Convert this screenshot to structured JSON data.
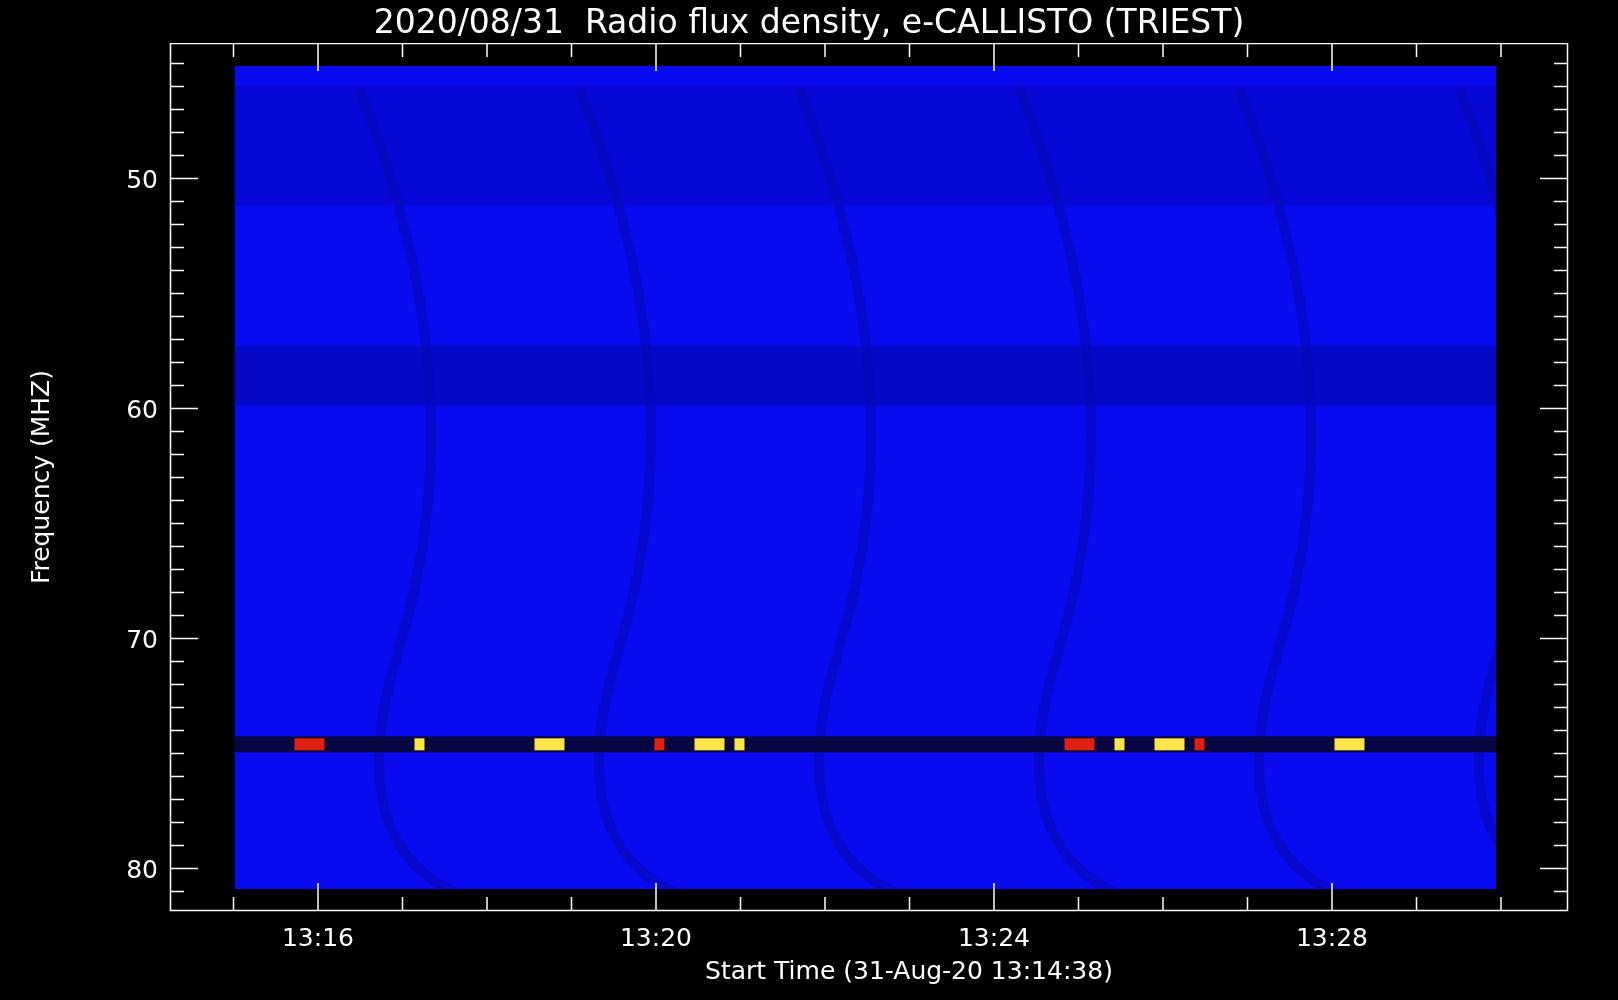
{
  "title": "2020/08/31  Radio flux density, e-CALLISTO (TRIEST)",
  "y_axis": {
    "label": "Frequency (MHZ)",
    "ticks": [
      "50",
      "60",
      "70",
      "80"
    ]
  },
  "x_axis": {
    "label": "Start Time (31-Aug-20 13:14:38)",
    "ticks": [
      "13:16",
      "13:20",
      "13:24",
      "13:28"
    ]
  }
}
